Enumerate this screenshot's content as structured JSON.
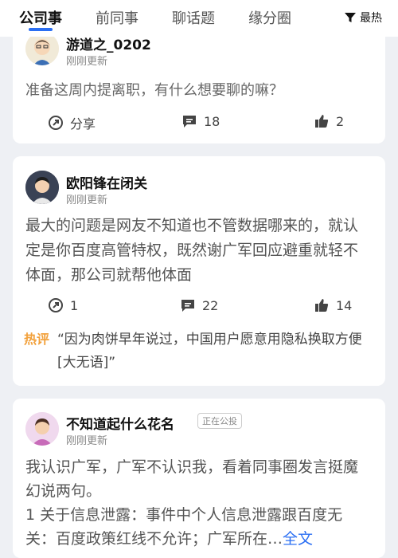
{
  "tabs": {
    "company": "公司事",
    "former_colleagues": "前同事",
    "topics": "聊话题",
    "fate": "缘分圈"
  },
  "sort": {
    "label": "最热"
  },
  "posts": [
    {
      "username": "游道之_0202",
      "time": "刚刚更新",
      "content": "准备这周内提离职，有什么想要聊的嘛？",
      "share_label": "分享",
      "comments": "18",
      "likes": "2"
    },
    {
      "username": "欧阳锋在闭关",
      "time": "刚刚更新",
      "content": "最大的问题是网友不知道也不管数据哪来的，就认定是你百度高管特权，既然谢广军回应避重就轻不体面，那公司就帮他体面",
      "shares": "1",
      "comments": "22",
      "likes": "14",
      "hot_label": "热评",
      "hot_comment": "“因为肉饼早年说过，中国用户愿意用隐私换取方便[大无语]”"
    },
    {
      "username": "不知道起什么花名",
      "badge": "正在公投",
      "time": "刚刚更新",
      "content_line1": "我认识广军，广军不认识我，看着同事圈发言挺魔幻说两句。",
      "content_line2": "1 关于信息泄露：事件中个人信息泄露跟百度无关：百度政策红线不允许；广军所在…",
      "more_label": "全文"
    }
  ]
}
